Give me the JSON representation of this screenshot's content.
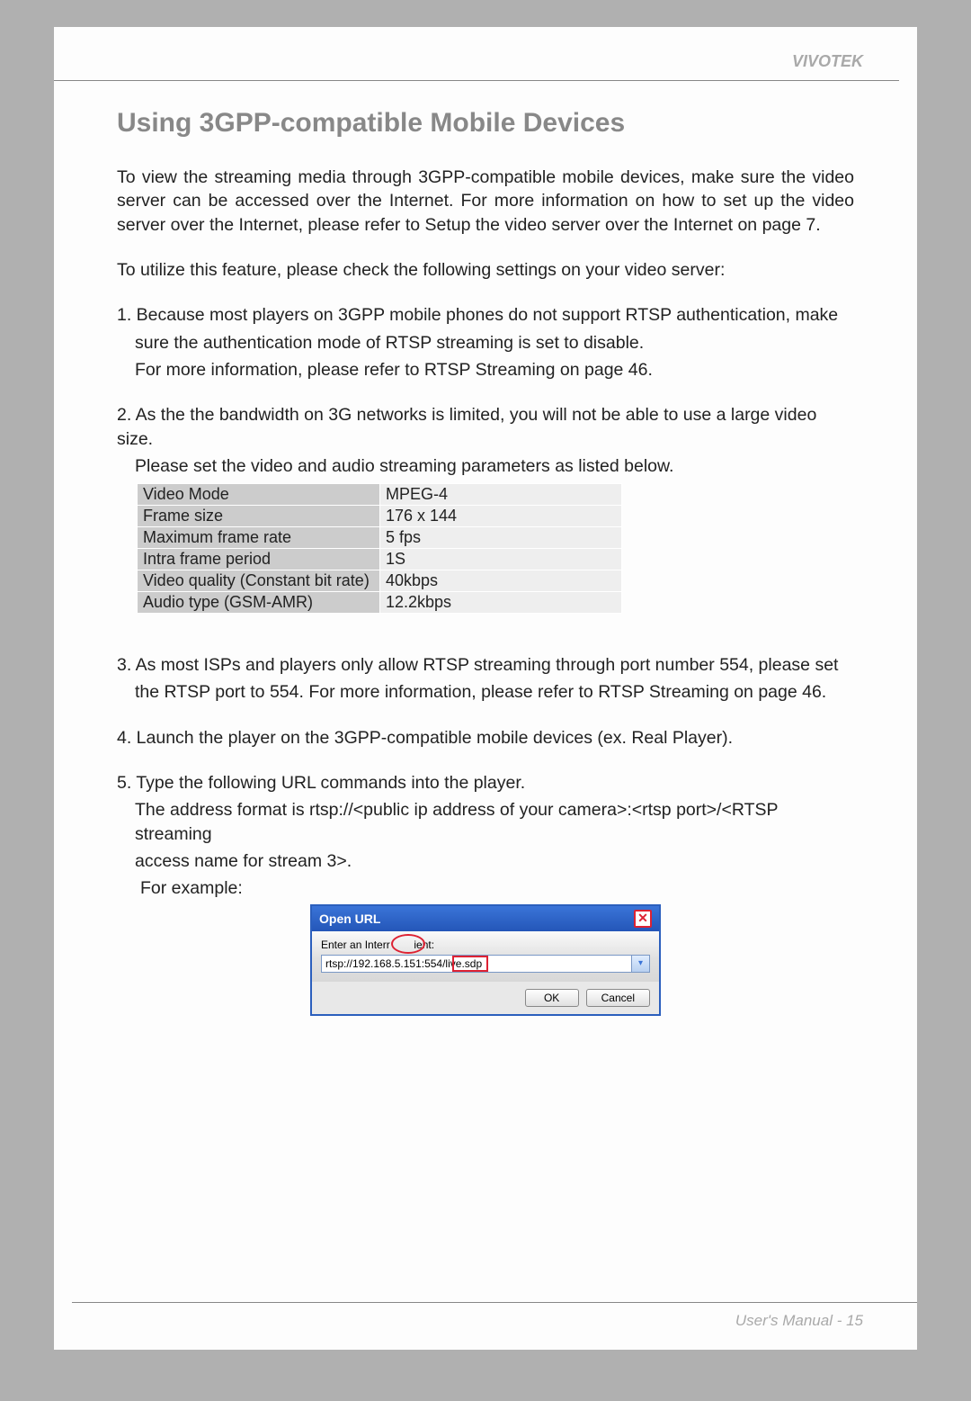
{
  "brand": "VIVOTEK",
  "heading": "Using 3GPP-compatible Mobile Devices",
  "intro": "To view the streaming media through 3GPP-compatible mobile devices, make sure the video server can be accessed over the Internet. For more information on how to set up the video server over the Internet, please refer to Setup the video server over the Internet on page 7.",
  "para_feature": "To utilize this feature, please check the following settings on your video server:",
  "item1_a": "1. Because most players on 3GPP mobile phones do not support RTSP authentication, make",
  "item1_b": "sure the authentication mode of RTSP streaming is set to disable.",
  "item1_c": "For more information, please refer to RTSP Streaming on page 46.",
  "item2_a": "2. As the the bandwidth on 3G networks is limited, you will not be able to use a large video size.",
  "item2_b": "Please set the video and audio streaming parameters as listed below.",
  "table": {
    "rows": [
      {
        "label": "Video Mode",
        "value": "MPEG-4"
      },
      {
        "label": "Frame size",
        "value": "176 x 144"
      },
      {
        "label": "Maximum frame rate",
        "value": "5 fps"
      },
      {
        "label": "Intra frame period",
        "value": "1S"
      },
      {
        "label": "Video quality (Constant bit rate)",
        "value": "40kbps"
      },
      {
        "label": "Audio type (GSM-AMR)",
        "value": "12.2kbps"
      }
    ]
  },
  "item3_a": "3. As most ISPs and players only allow RTSP streaming through port number 554, please set",
  "item3_b": "the RTSP port to 554. For more information, please refer to RTSP Streaming on page 46.",
  "item4": "4. Launch the player on the 3GPP-compatible mobile devices (ex. Real Player).",
  "item5_a": "5. Type the following URL commands into the player.",
  "item5_b": "The address format is rtsp://<public ip address of your camera>:<rtsp port>/<RTSP streaming",
  "item5_c": "access name for stream 3>.",
  "item5_d": "For example:",
  "dialog": {
    "title": "Open URL",
    "label_a": "Enter an Interr",
    "label_b": "ient:",
    "input": "rtsp://192.168.5.151:554/live.sdp",
    "ok": "OK",
    "cancel": "Cancel"
  },
  "footer": "User's Manual - 15"
}
